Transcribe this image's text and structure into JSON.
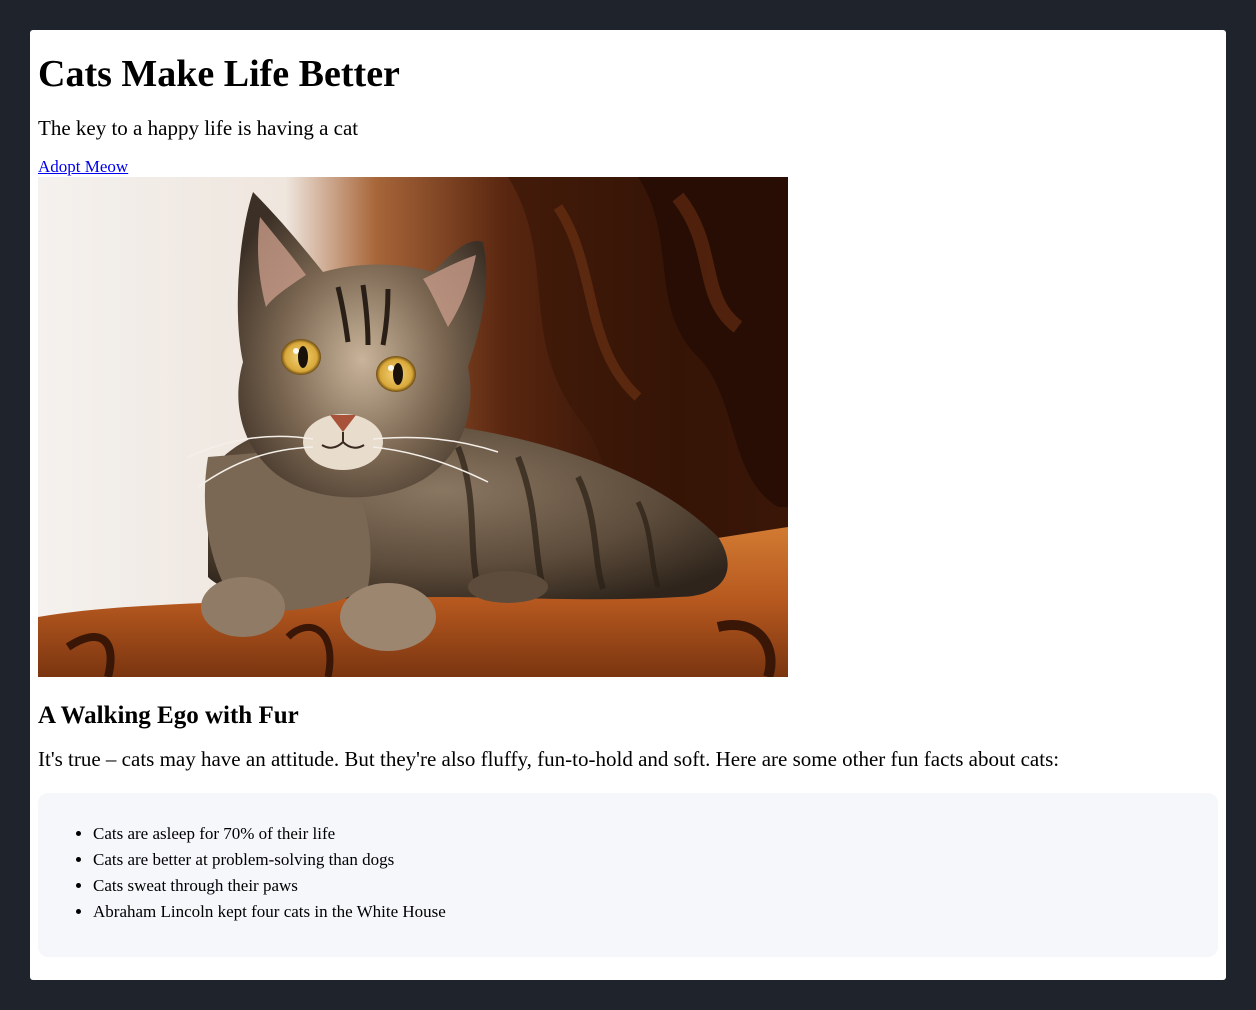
{
  "header": {
    "title": "Cats Make Life Better",
    "tagline": "The key to a happy life is having a cat",
    "adopt_link": "Adopt Meow"
  },
  "hero_image": {
    "alt": "tabby cat lying on an orange armchair",
    "colors": {
      "background_dark": "#3a1a0c",
      "chair": "#b5581f",
      "fur": "#6e5c48",
      "eye": "#d9b04a"
    }
  },
  "section": {
    "heading": "A Walking Ego with Fur",
    "intro": "It's true – cats may have an attitude. But they're also fluffy, fun-to-hold and soft. Here are some other fun facts about cats:",
    "facts": [
      "Cats are asleep for 70% of their life",
      "Cats are better at problem-solving than dogs",
      "Cats sweat through their paws",
      "Abraham Lincoln kept four cats in the White House"
    ]
  },
  "theme": {
    "page_background": "#1f232b",
    "card_background": "#ffffff",
    "facts_background": "#f6f7fb",
    "link_color": "#0000ee"
  }
}
